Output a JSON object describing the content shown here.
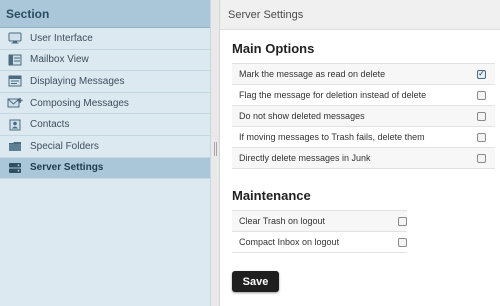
{
  "sidebar": {
    "header": "Section",
    "items": [
      {
        "label": "User Interface",
        "icon": "monitor-icon"
      },
      {
        "label": "Mailbox View",
        "icon": "mailbox-icon"
      },
      {
        "label": "Displaying Messages",
        "icon": "display-icon"
      },
      {
        "label": "Composing Messages",
        "icon": "compose-icon"
      },
      {
        "label": "Contacts",
        "icon": "contacts-icon"
      },
      {
        "label": "Special Folders",
        "icon": "folder-icon"
      },
      {
        "label": "Server Settings",
        "icon": "server-icon",
        "active": true
      }
    ]
  },
  "content": {
    "header": "Server Settings",
    "main_options": {
      "title": "Main Options",
      "rows": [
        {
          "label": "Mark the message as read on delete",
          "checked": true
        },
        {
          "label": "Flag the message for deletion instead of delete",
          "checked": false
        },
        {
          "label": "Do not show deleted messages",
          "checked": false
        },
        {
          "label": "If moving messages to Trash fails, delete them",
          "checked": false
        },
        {
          "label": "Directly delete messages in Junk",
          "checked": false
        }
      ]
    },
    "maintenance": {
      "title": "Maintenance",
      "rows": [
        {
          "label": "Clear Trash on logout",
          "checked": false
        },
        {
          "label": "Compact Inbox on logout",
          "checked": false
        }
      ]
    },
    "save_label": "Save"
  },
  "colors": {
    "sidebar_bg": "#dce9f1",
    "sidebar_header_bg": "#aac7d9",
    "active_item_bg": "#aac7d9",
    "save_button_bg": "#1f1f1f"
  }
}
